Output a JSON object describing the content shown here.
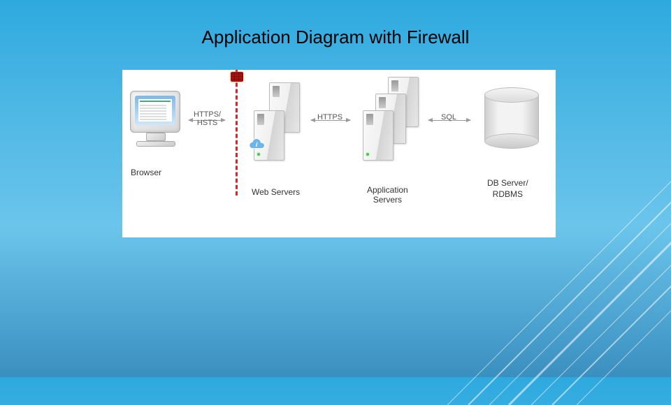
{
  "title": "Application Diagram with Firewall",
  "nodes": {
    "browser": {
      "label": "Browser"
    },
    "webservers": {
      "label": "Web Servers"
    },
    "appservers": {
      "label": "Application\nServers"
    },
    "dbserver": {
      "label_line1": "DB Server/",
      "label_line2": "RDBMS"
    }
  },
  "connections": {
    "browser_to_web": {
      "label": "HTTPS/\nHSTS"
    },
    "web_to_app": {
      "label": "HTTPS"
    },
    "app_to_db": {
      "label": "SQL"
    }
  },
  "firewall": {
    "icon": "firewall-icon"
  }
}
